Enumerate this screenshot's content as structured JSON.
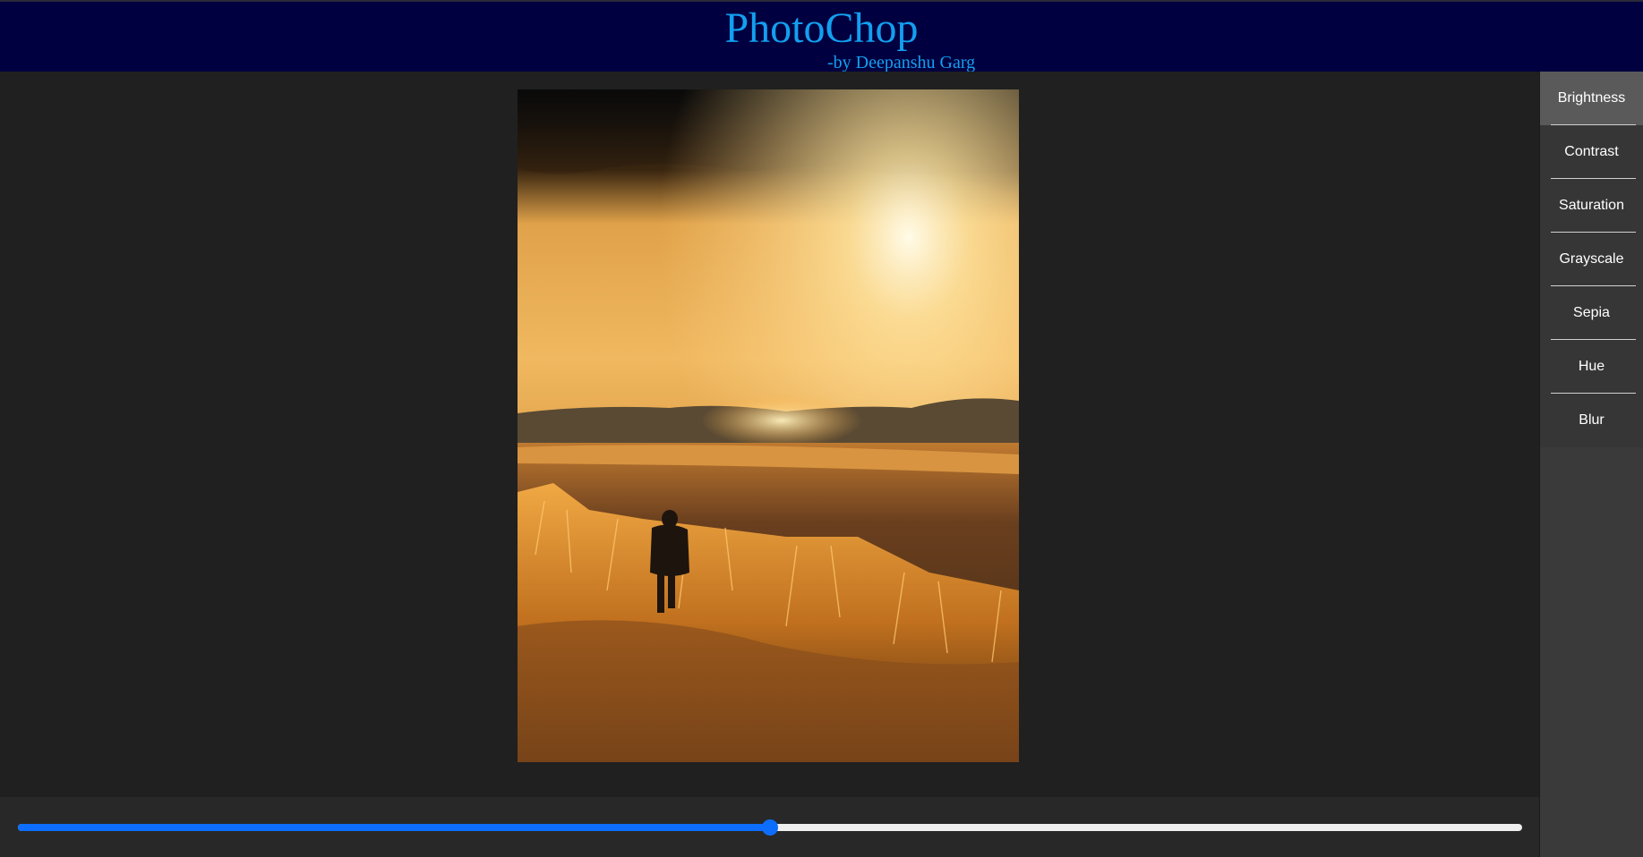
{
  "header": {
    "title": "PhotoChop",
    "subtitle": "-by Deepanshu Garg"
  },
  "filters": [
    {
      "label": "Brightness",
      "active": true
    },
    {
      "label": "Contrast",
      "active": false
    },
    {
      "label": "Saturation",
      "active": false
    },
    {
      "label": "Grayscale",
      "active": false
    },
    {
      "label": "Sepia",
      "active": false
    },
    {
      "label": "Hue",
      "active": false
    },
    {
      "label": "Blur",
      "active": false
    }
  ],
  "slider": {
    "value_fraction": 0.5
  },
  "colors": {
    "header_bg": "#000040",
    "title_color": "#139ff0",
    "accent": "#0d6efd"
  }
}
